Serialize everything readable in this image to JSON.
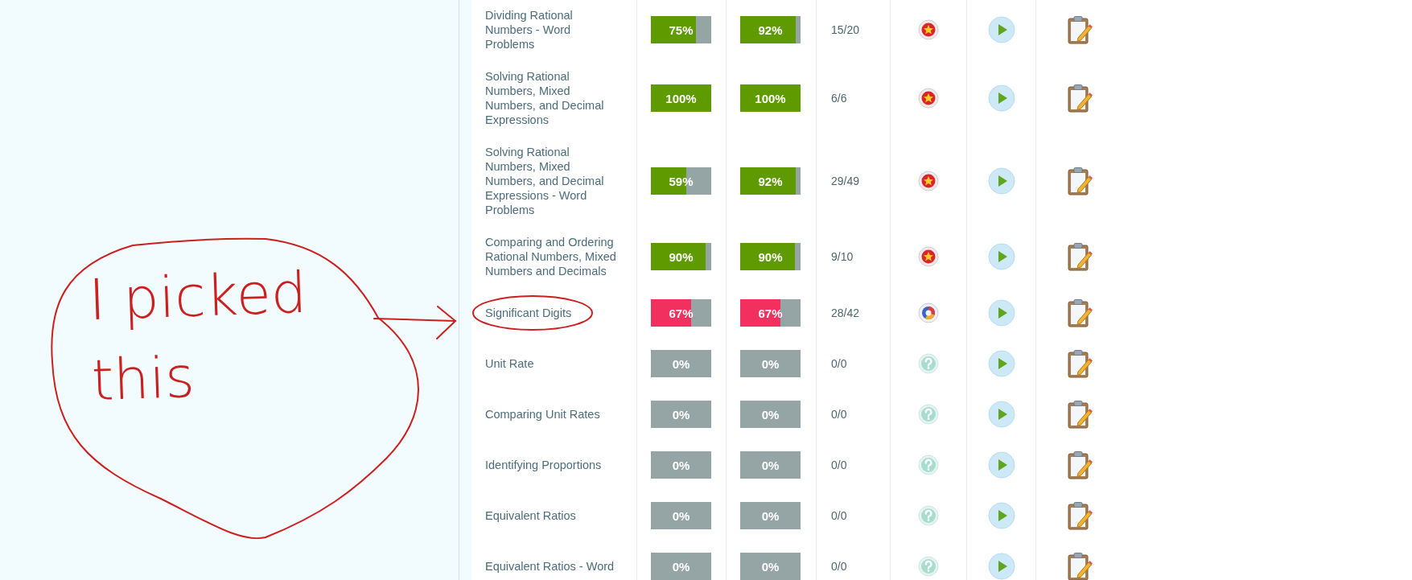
{
  "rows": [
    {
      "name": "Dividing Rational Numbers - Word Problems",
      "scores": [
        {
          "text": "75%",
          "level": 0.75
        },
        {
          "text": "92%",
          "level": 0.92
        }
      ],
      "fraction": "15/20",
      "kind": "mastered"
    },
    {
      "name": "Solving Rational Numbers, Mixed Numbers, and Decimal Expressions",
      "scores": [
        {
          "text": "100%",
          "level": 1
        },
        {
          "text": "100%",
          "level": 1
        }
      ],
      "fraction": "6/6",
      "kind": "mastered"
    },
    {
      "name": "Solving Rational Numbers, Mixed Numbers, and Decimal Expressions - Word Problems",
      "scores": [
        {
          "text": "59%",
          "level": 0.59
        },
        {
          "text": "92%",
          "level": 0.92
        }
      ],
      "fraction": "29/49",
      "kind": "mastered"
    },
    {
      "name": "Comparing and Ordering Rational Numbers, Mixed Numbers and Decimals",
      "scores": [
        {
          "text": "90%",
          "level": 0.9
        },
        {
          "text": "90%",
          "level": 0.9
        }
      ],
      "fraction": "9/10",
      "kind": "mastered"
    },
    {
      "name": "Significant Digits",
      "scores": [
        {
          "text": "67%",
          "level": 0.67
        },
        {
          "text": "67%",
          "level": 0.67
        }
      ],
      "fraction": "28/42",
      "kind": "in-progress"
    },
    {
      "name": "Unit Rate",
      "scores": [
        {
          "text": "0%",
          "level": 0
        },
        {
          "text": "0%",
          "level": 0
        }
      ],
      "fraction": "0/0",
      "kind": "not-started"
    },
    {
      "name": "Comparing Unit Rates",
      "scores": [
        {
          "text": "0%",
          "level": 0
        },
        {
          "text": "0%",
          "level": 0
        }
      ],
      "fraction": "0/0",
      "kind": "not-started"
    },
    {
      "name": "Identifying Proportions",
      "scores": [
        {
          "text": "0%",
          "level": 0
        },
        {
          "text": "0%",
          "level": 0
        }
      ],
      "fraction": "0/0",
      "kind": "not-started"
    },
    {
      "name": "Equivalent Ratios",
      "scores": [
        {
          "text": "0%",
          "level": 0
        },
        {
          "text": "0%",
          "level": 0
        }
      ],
      "fraction": "0/0",
      "kind": "not-started"
    },
    {
      "name": "Equivalent Ratios - Word",
      "scores": [
        {
          "text": "0%",
          "level": 0
        },
        {
          "text": "0%",
          "level": 0
        }
      ],
      "fraction": "0/0",
      "kind": "not-started"
    }
  ],
  "annotation": {
    "text": "I picked this"
  }
}
